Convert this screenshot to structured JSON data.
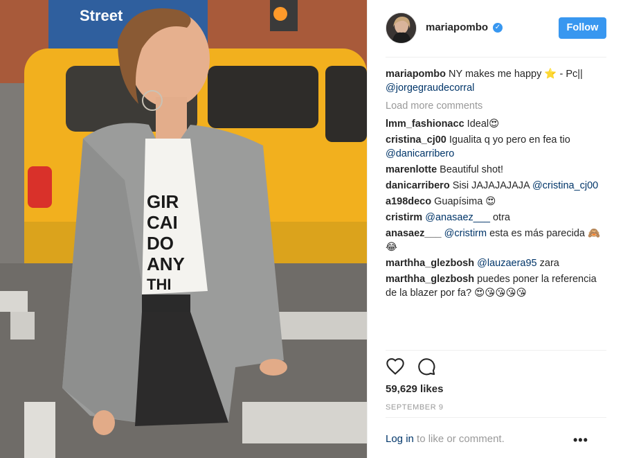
{
  "post": {
    "author": "mariapombo",
    "follow_label": "Follow",
    "caption": {
      "user": "mariapombo",
      "text": "NY makes me happy ⭐️ - Pc||",
      "mention": "@jorgegraudecorral"
    },
    "load_more": "Load more comments",
    "comments": [
      {
        "user": "lmm_fashionacc",
        "text": "Ideal😍",
        "mention": ""
      },
      {
        "user": "cristina_cj00",
        "text": "Igualita q yo pero en fea tio",
        "mention": "@danicarribero"
      },
      {
        "user": "marenlotte",
        "text": "Beautiful shot!",
        "mention": ""
      },
      {
        "user": "danicarribero",
        "text": "Sisi JAJAJAJAJA",
        "mention": "@cristina_cj00"
      },
      {
        "user": "a198deco",
        "text": "Guapísima 😍",
        "mention": ""
      }
    ],
    "comments2": [
      {
        "user": "cristirm",
        "pre": "",
        "mention": "@anasaez___",
        "post": " otra"
      },
      {
        "user": "anasaez___",
        "pre": "",
        "mention": "@cristirm",
        "post": " esta es más parecida 🙈😂"
      },
      {
        "user": "marthha_glezbosh",
        "pre": "",
        "mention": "@lauzaera95",
        "post": " zara"
      },
      {
        "user": "marthha_glezbosh",
        "pre": "puedes poner la referencia de la blazer por fa? 😍😘😘😘😘",
        "mention": "",
        "post": ""
      }
    ],
    "likes": "59,629 likes",
    "date": "SEPTEMBER 9",
    "login_link": "Log in",
    "login_suffix": " to like or comment.",
    "more_options": "•••",
    "photo_text": [
      "GIR",
      "CAI",
      "DO",
      "ANY",
      "THI"
    ],
    "sign_text": "Street"
  },
  "colors": {
    "accent": "#3897f0",
    "link": "#003569",
    "muted": "#999999",
    "taxi": "#f2b01e"
  },
  "icons": [
    "heart-icon",
    "comment-icon",
    "verified-icon",
    "more-options-icon"
  ]
}
